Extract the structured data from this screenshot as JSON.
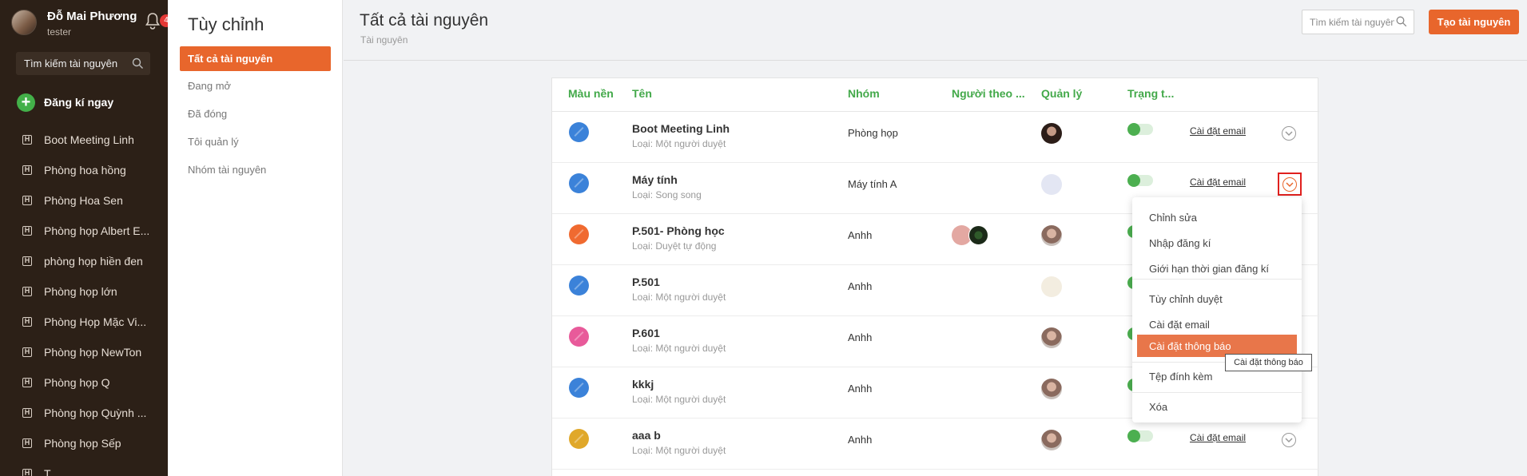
{
  "sidebar": {
    "user_name": "Đỗ Mai Phương",
    "user_role": "tester",
    "notification_count": "4",
    "search_placeholder": "Tìm kiếm tài nguyên",
    "register_label": "Đăng kí ngay",
    "items": [
      {
        "label": "Boot Meeting Linh"
      },
      {
        "label": "Phòng hoa hồng"
      },
      {
        "label": "Phòng Hoa Sen"
      },
      {
        "label": "Phòng họp Albert E..."
      },
      {
        "label": "phòng họp hiền đen"
      },
      {
        "label": "Phòng họp lớn"
      },
      {
        "label": "Phòng Họp Mặc Vi..."
      },
      {
        "label": "Phòng họp NewTon"
      },
      {
        "label": "Phòng họp Q"
      },
      {
        "label": "Phòng họp Quỳnh ..."
      },
      {
        "label": "Phòng họp Sếp"
      },
      {
        "label": "T"
      }
    ]
  },
  "subnav": {
    "title": "Tùy chỉnh",
    "items": [
      {
        "label": "Tất cả tài nguyên",
        "active": true
      },
      {
        "label": "Đang mở"
      },
      {
        "label": "Đã đóng"
      },
      {
        "label": "Tôi quản lý"
      },
      {
        "label": "Nhóm tài nguyên"
      }
    ]
  },
  "header": {
    "title": "Tất cả tài nguyên",
    "subtitle": "Tài nguyên",
    "search_placeholder": "Tìm kiếm tài nguyên",
    "create_button": "Tạo tài nguyên"
  },
  "table": {
    "columns": [
      "Màu nền",
      "Tên",
      "Nhóm",
      "Người theo ...",
      "Quản lý",
      "Trạng t..."
    ],
    "rows": [
      {
        "name": "Boot Meeting Linh",
        "type": "Loại: Một người duyệt",
        "group": "Phòng họp",
        "color": "#3b82d9",
        "email": "Cài đặt email"
      },
      {
        "name": "Máy tính",
        "type": "Loại: Song song",
        "group": "Máy tính A",
        "color": "#3b82d9",
        "email": "Cài đặt email"
      },
      {
        "name": "P.501- Phòng học",
        "type": "Loại: Duyệt tự động",
        "group": "Anhh",
        "color": "#f06a30"
      },
      {
        "name": "P.501",
        "type": "Loại: Một người duyệt",
        "group": "Anhh",
        "color": "#3b82d9"
      },
      {
        "name": "P.601",
        "type": "Loại: Một người duyệt",
        "group": "Anhh",
        "color": "#e85a9a"
      },
      {
        "name": "kkkj",
        "type": "Loại: Một người duyệt",
        "group": "Anhh",
        "color": "#3b82d9"
      },
      {
        "name": "aaa b",
        "type": "Loại: Một người duyệt",
        "group": "Anhh",
        "color": "#e0a82a",
        "email": "Cài đặt email"
      }
    ]
  },
  "menu": {
    "items": [
      {
        "label": "Chỉnh sửa"
      },
      {
        "label": "Nhập đăng kí"
      },
      {
        "label": "Giới hạn thời gian đăng kí"
      },
      {
        "label": "Tùy chỉnh duyệt"
      },
      {
        "label": "Cài đặt email"
      },
      {
        "label": "Cài đặt thông báo",
        "active": true
      },
      {
        "label": "Tệp đính kèm"
      },
      {
        "label": "Xóa"
      }
    ],
    "tooltip": "Cài đặt thông báo"
  },
  "colors": {
    "accent": "#e8662c",
    "sidebar_bg": "#2c2017",
    "header_green": "#43a94a",
    "toggle_on": "#4caf50"
  }
}
